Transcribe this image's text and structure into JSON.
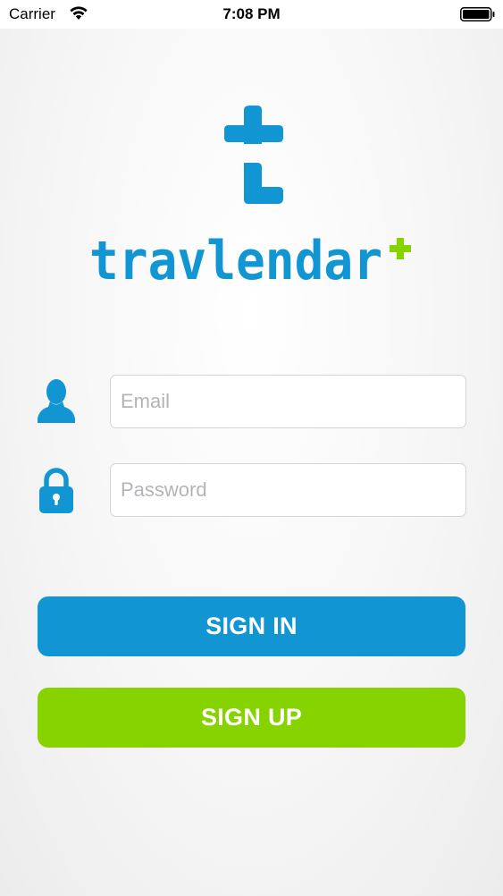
{
  "status_bar": {
    "carrier": "Carrier",
    "time": "7:08 PM",
    "wifi_icon": "wifi-icon",
    "battery_icon": "battery-icon"
  },
  "logo": {
    "mark_icon": "travlendar-t-logo-icon",
    "wordmark": "travlendar+",
    "brand_blue": "#1195d3",
    "brand_green": "#86d300"
  },
  "form": {
    "email": {
      "icon": "user-icon",
      "placeholder": "Email",
      "value": ""
    },
    "password": {
      "icon": "lock-icon",
      "placeholder": "Password",
      "value": ""
    }
  },
  "buttons": {
    "sign_in": "SIGN IN",
    "sign_up": "SIGN UP"
  }
}
